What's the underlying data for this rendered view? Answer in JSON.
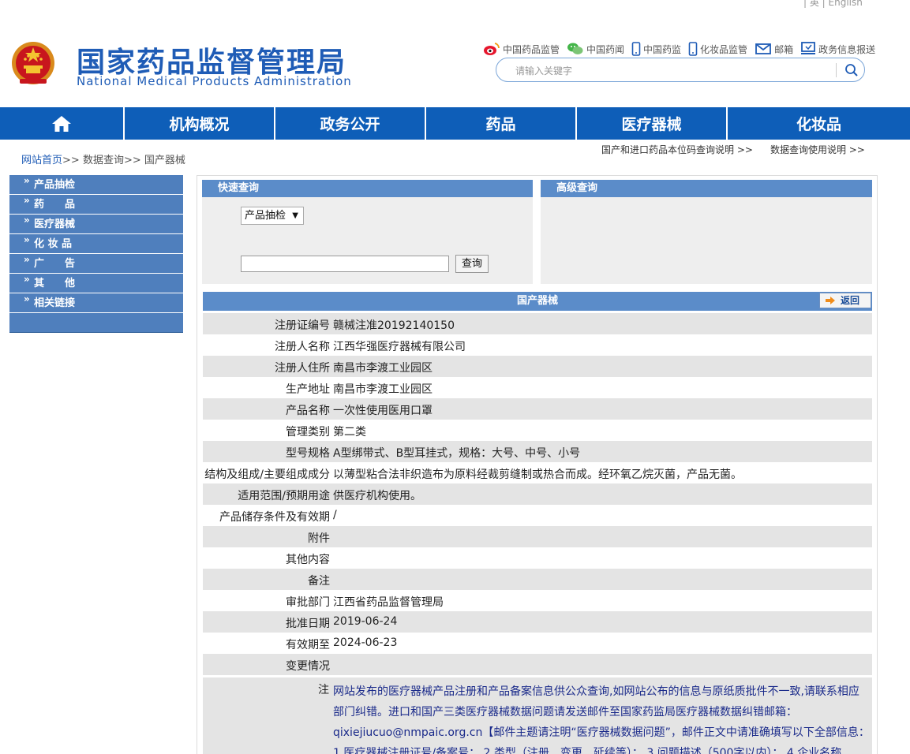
{
  "header": {
    "lang_switch": "| 英 | English",
    "title_cn": "国家药品监督管理局",
    "title_en": "National Medical Products Administration",
    "top_links": [
      {
        "label": "中国药品监管",
        "icon": "weibo-icon"
      },
      {
        "label": "中国药闻",
        "icon": "wechat-icon"
      },
      {
        "label": "中国药监",
        "icon": "mobile-icon"
      },
      {
        "label": "化妆品监管",
        "icon": "mobile-icon"
      },
      {
        "label": "邮箱",
        "icon": "mail-icon"
      },
      {
        "label": "政务信息报送",
        "icon": "monitor-icon"
      }
    ],
    "search": {
      "placeholder": "请输入关键字"
    }
  },
  "nav": {
    "home_icon": "home-icon",
    "items": [
      "机构概况",
      "政务公开",
      "药品",
      "医疗器械",
      "化妆品"
    ]
  },
  "breadcrumb": {
    "home": "网站首页",
    "sep": ">>",
    "level2": "数据查询",
    "level3": "国产器械"
  },
  "right_links": [
    "国产和进口药品本位码查询说明 >>",
    "数据查询使用说明 >>"
  ],
  "left_menu": {
    "arrow": "»",
    "items": [
      "产品抽检",
      "药　　品",
      "医疗器械",
      "化 妆 品",
      "广　　告",
      "其　　他",
      "相关链接"
    ]
  },
  "quick": {
    "title": "快速查询",
    "select_value": "产品抽检",
    "query_button": "查询"
  },
  "advanced": {
    "title": "高级查询"
  },
  "detail": {
    "title": "国产器械",
    "back_label": "返回",
    "rows": [
      {
        "k": "注册证编号",
        "v": "赣械注准20192140150"
      },
      {
        "k": "注册人名称",
        "v": "江西华强医疗器械有限公司"
      },
      {
        "k": "注册人住所",
        "v": "南昌市李渡工业园区"
      },
      {
        "k": "生产地址",
        "v": "南昌市李渡工业园区"
      },
      {
        "k": "产品名称",
        "v": "一次性使用医用口罩"
      },
      {
        "k": "管理类别",
        "v": "第二类"
      },
      {
        "k": "型号规格",
        "v": "A型绑带式、B型耳挂式，规格：大号、中号、小号"
      },
      {
        "k": "结构及组成/主要组成成分",
        "v": "以薄型粘合法非织造布为原料经裁剪缝制或热合而成。经环氧乙烷灭菌，产品无菌。"
      },
      {
        "k": "适用范围/预期用途",
        "v": "供医疗机构使用。"
      },
      {
        "k": "产品储存条件及有效期",
        "v": "/"
      },
      {
        "k": "附件",
        "v": ""
      },
      {
        "k": "其他内容",
        "v": ""
      },
      {
        "k": "备注",
        "v": ""
      },
      {
        "k": "审批部门",
        "v": "江西省药品监督管理局"
      },
      {
        "k": "批准日期",
        "v": "2019-06-24"
      },
      {
        "k": "有效期至",
        "v": "2024-06-23"
      },
      {
        "k": "变更情况",
        "v": ""
      }
    ],
    "note_key": "注",
    "note_text": "网站发布的医疗器械产品注册和产品备案信息供公众查询,如网站公布的信息与原纸质批件不一致,请联系相应部门纠错。进口和国产三类医疗器械数据问题请发送邮件至国家药监局医疗器械数据纠错邮箱：qixiejiucuo@nmpaic.org.cn【邮件主题请注明“医疗器械数据问题”，邮件正文中请准确填写以下全部信息：1.医疗器械注册证号/备案号； 2.类型（注册、变更、延续等）； 3.问题描述（500字以内）； 4.企业名称"
  }
}
